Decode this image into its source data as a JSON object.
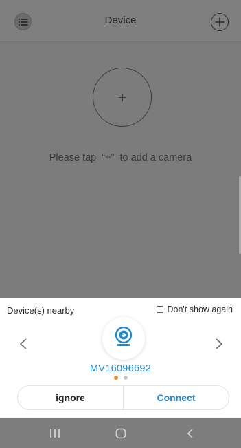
{
  "header": {
    "title": "Device",
    "menu_icon": "list-icon",
    "add_icon": "plus-circle-icon"
  },
  "main": {
    "add_camera_icon": "plus-circle-icon",
    "hint": "Please tap  “+”  to add a camera"
  },
  "nearby": {
    "title": "Device(s) nearby",
    "dont_show_label": "Don't show again",
    "dont_show_checked": false,
    "device_id": "MV16096692",
    "device_icon": "webcam-icon",
    "prev_icon": "chevron-left-icon",
    "next_icon": "chevron-right-icon",
    "page_count": 2,
    "current_page": 1,
    "ignore_label": "ignore",
    "connect_label": "Connect"
  },
  "colors": {
    "accent": "#1d8ad6",
    "active_dot": "#f08b2b",
    "inactive_dot": "#c8c8c8"
  },
  "system_nav": {
    "recent_icon": "recent-apps-icon",
    "home_icon": "home-icon",
    "back_icon": "back-icon"
  }
}
